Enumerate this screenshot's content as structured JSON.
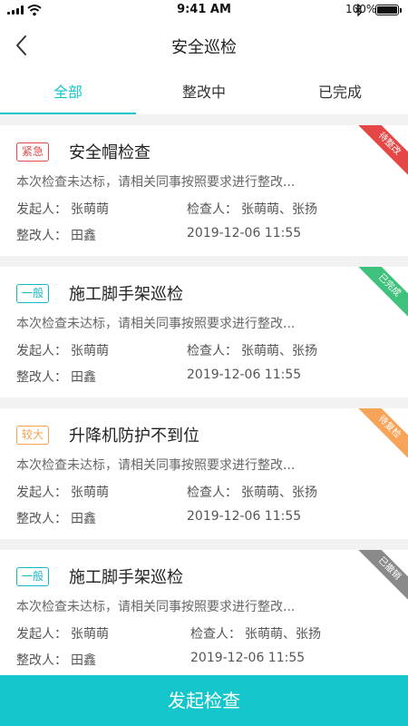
{
  "status_bar": {
    "time": "9:41 AM",
    "battery": "100%",
    "battery_level": 1.0
  },
  "nav": {
    "title": "安全巡检",
    "back_icon": "chevron-left-icon"
  },
  "tabs": [
    {
      "label": "全部",
      "active": true
    },
    {
      "label": "整改中",
      "active": false
    },
    {
      "label": "已完成",
      "active": false
    }
  ],
  "labels": {
    "initiator": "发起人：",
    "inspector": "检查人：",
    "rectifier": "整改人："
  },
  "items": [
    {
      "tag": "紧急",
      "title": "安全帽检查",
      "desc": "本次检查未达标，请相关同事按照要求进行整改...",
      "initiator": "张萌萌",
      "inspector": "张萌萌、张扬",
      "rectifier": "田鑫",
      "date": "2019-12-06 11:55",
      "status": "待整改"
    },
    {
      "tag": "一般",
      "title": "施工脚手架巡检",
      "desc": "本次检查未达标，请相关同事按照要求进行整改...",
      "initiator": "张萌萌",
      "inspector": "张萌萌、张扬",
      "rectifier": "田鑫",
      "date": "2019-12-06 11:55",
      "status": "已完成"
    },
    {
      "tag": "较大",
      "title": "升降机防护不到位",
      "desc": "本次检查未达标，请相关同事按照要求进行整改...",
      "initiator": "张萌萌",
      "inspector": "张萌萌、张扬",
      "rectifier": "田鑫",
      "date": "2019-12-06 11:55",
      "status": "待复检"
    },
    {
      "tag": "一般",
      "title": "施工脚手架巡检",
      "desc": "本次检查未达标，请相关同事按照要求进行整改...",
      "initiator": "张萌萌",
      "inspector": "张萌萌、张扬",
      "rectifier": "田鑫",
      "date": "2019-12-06 11:55",
      "status": "已撤销"
    }
  ],
  "colors": {
    "accent": "#14c6cc",
    "urgent": "#e04b4b",
    "normal": "#14b8c0",
    "major": "#f5a04e",
    "done": "#3ec27c",
    "cancelled": "#8a8a8a"
  },
  "footer": {
    "button_label": "发起检查"
  }
}
